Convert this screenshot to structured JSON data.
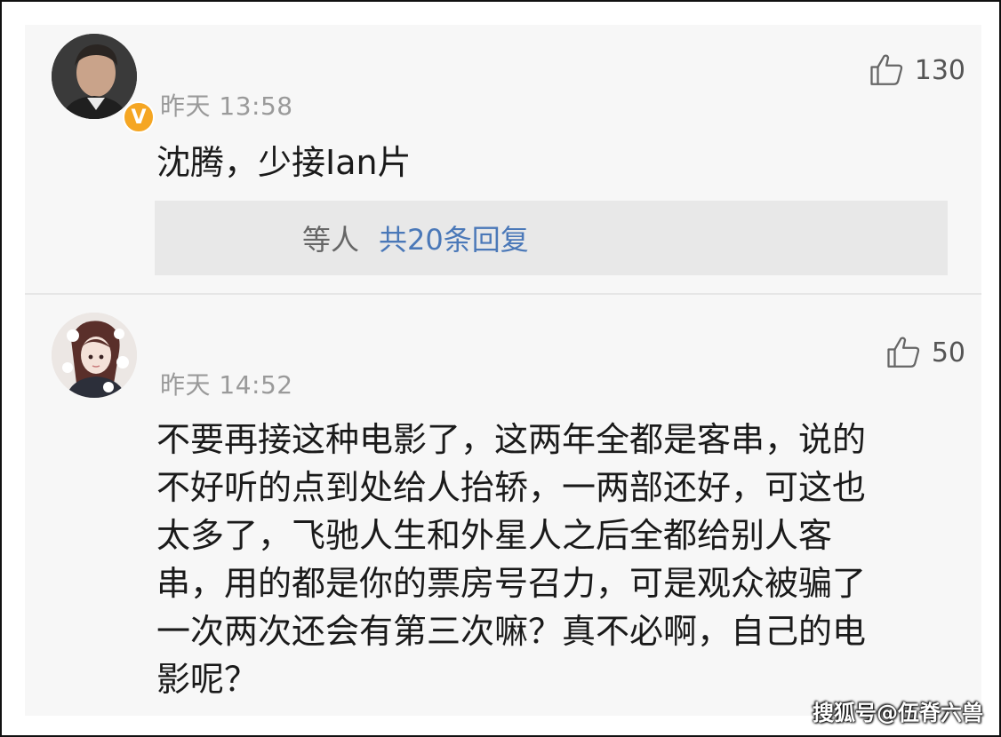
{
  "comments": [
    {
      "timestamp": "昨天 13:58",
      "likes": "130",
      "verified": true,
      "verified_mark": "V",
      "text_lines": [
        "沈腾，少接Ian片"
      ],
      "replies": {
        "who": "等人",
        "count_text": "共20条回复"
      },
      "avatar_icon": "man-portrait-avatar"
    },
    {
      "timestamp": "昨天 14:52",
      "likes": "50",
      "verified": false,
      "text_lines": [
        "不要再接这种电影了，这两年全都是客串，说的",
        "不好听的点到处给人抬轿，一两部还好，可这也",
        "太多了，飞驰人生和外星人之后全都给别人客",
        "串，用的都是你的票房号召力，可是观众被骗了",
        "一次两次还会有第三次嘛？真不必啊，自己的电",
        "影呢？"
      ],
      "avatar_icon": "anime-girl-flowers-avatar"
    }
  ],
  "watermark": "搜狐号@伍脊六兽",
  "colors": {
    "panel_bg": "#f7f7f7",
    "reply_bg": "#e8e8e8",
    "reply_link": "#4a78b8",
    "timestamp": "#9a9a9a",
    "badge": "#f5a623"
  }
}
